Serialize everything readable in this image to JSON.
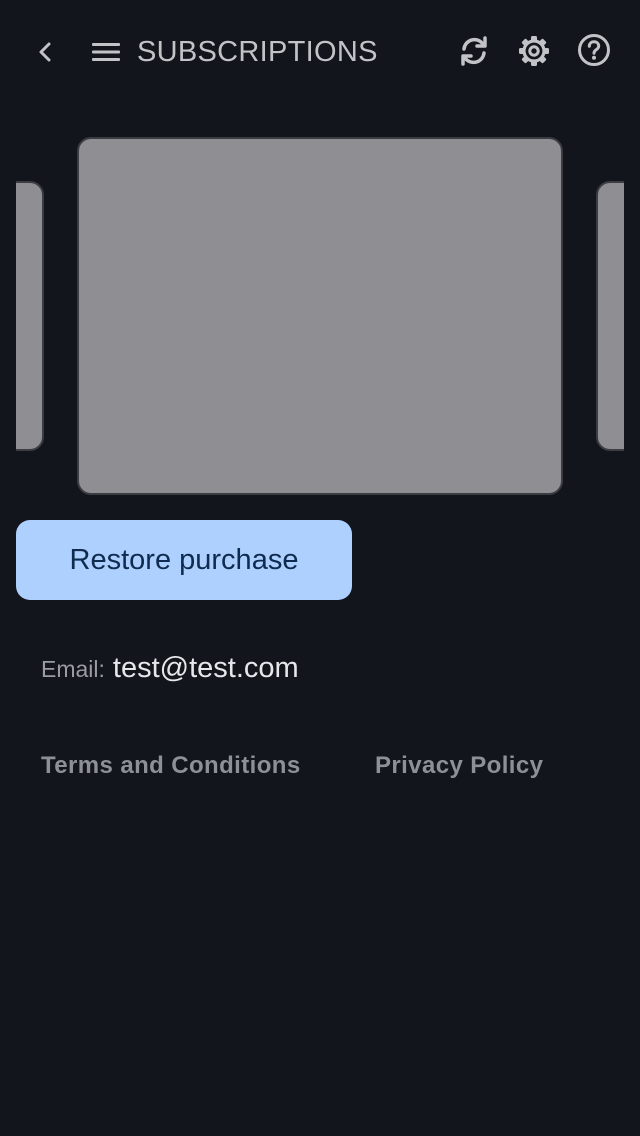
{
  "header": {
    "title": "SUBSCRIPTIONS",
    "back_icon": "chevron-left-icon",
    "menu_icon": "hamburger-menu-icon",
    "refresh_icon": "refresh-icon",
    "settings_icon": "gear-icon",
    "help_icon": "help-circle-icon"
  },
  "carousel": {
    "card_color": "#8e8e93"
  },
  "restore_button": {
    "label": "Restore purchase",
    "bg_color": "#aed0fe"
  },
  "account": {
    "email_label": "Email:",
    "email_value": "test@test.com"
  },
  "links": {
    "terms": "Terms and Conditions",
    "privacy": "Privacy Policy"
  },
  "colors": {
    "background": "#12151b"
  }
}
